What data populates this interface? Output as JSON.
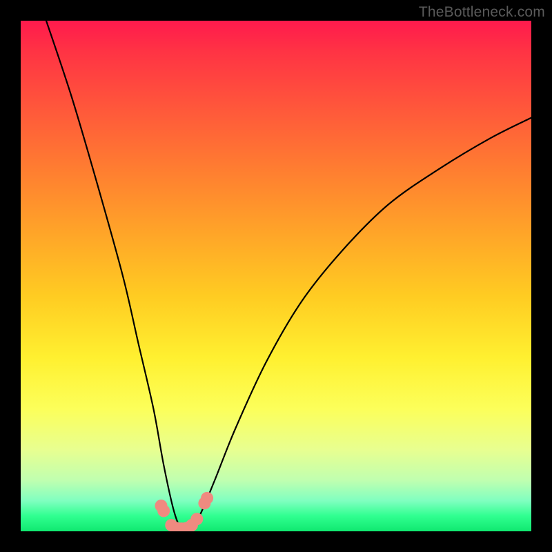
{
  "watermark": "TheBottleneck.com",
  "chart_data": {
    "type": "line",
    "title": "",
    "xlabel": "",
    "ylabel": "",
    "xlim": [
      0,
      100
    ],
    "ylim": [
      0,
      100
    ],
    "x": [
      5,
      10,
      15,
      20,
      23,
      26,
      28,
      30,
      31.5,
      33,
      35,
      38,
      42,
      48,
      55,
      63,
      72,
      82,
      92,
      100
    ],
    "values": [
      100,
      85,
      68,
      50,
      37,
      24,
      13,
      4,
      0.5,
      0.5,
      3,
      10,
      20,
      33,
      45,
      55,
      64,
      71,
      77,
      81
    ],
    "markers": {
      "x": [
        27.5,
        28,
        29.5,
        30.5,
        31,
        31.5,
        32,
        32.5,
        33,
        33.5,
        34.5,
        36,
        36.5
      ],
      "y": [
        5,
        4,
        1.2,
        0.6,
        0.5,
        0.5,
        0.5,
        0.6,
        0.8,
        1.2,
        2.4,
        5.5,
        6.5
      ]
    },
    "colors": {
      "curve": "#000000",
      "markers": "#ef8a80",
      "gradient_top": "#ff1a4d",
      "gradient_bottom": "#10e870"
    }
  }
}
